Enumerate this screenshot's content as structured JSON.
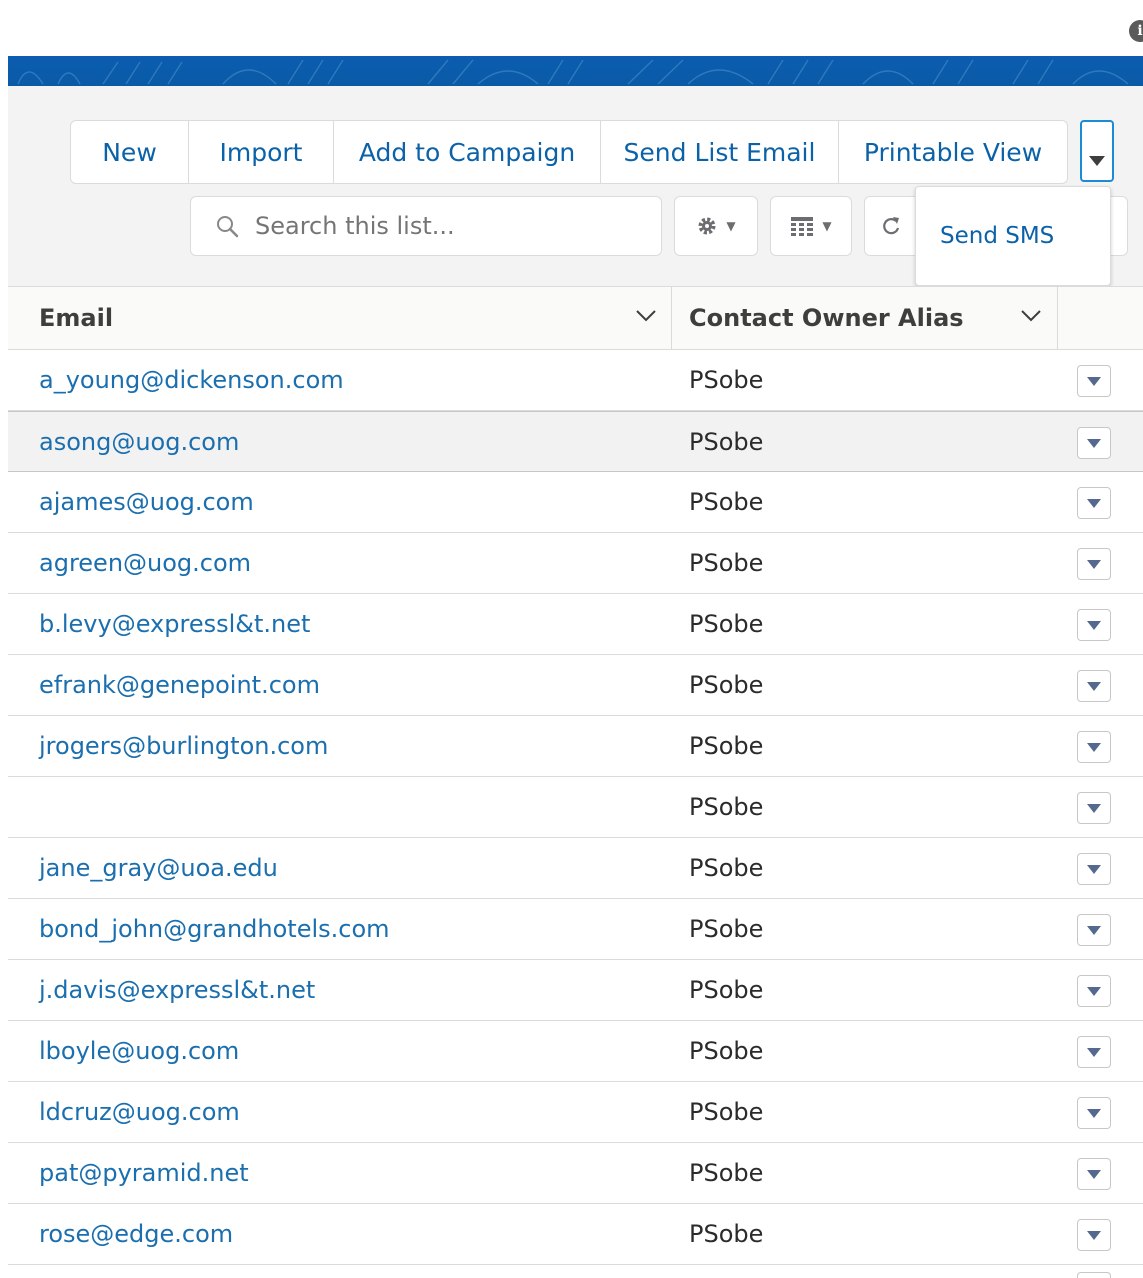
{
  "actions": {
    "new_label": "New",
    "import_label": "Import",
    "add_to_campaign_label": "Add to Campaign",
    "send_list_email_label": "Send List Email",
    "printable_view_label": "Printable View"
  },
  "more_menu": {
    "items": [
      {
        "label": "Send SMS"
      }
    ]
  },
  "search": {
    "placeholder": "Search this list..."
  },
  "toolbar_icons": [
    "gear-icon",
    "table-icon",
    "refresh-icon"
  ],
  "table": {
    "columns": [
      {
        "label": "Email"
      },
      {
        "label": "Contact Owner Alias"
      }
    ],
    "rows": [
      {
        "email": "a_young@dickenson.com",
        "owner": "PSobe"
      },
      {
        "email": "asong@uog.com",
        "owner": "PSobe"
      },
      {
        "email": "ajames@uog.com",
        "owner": "PSobe"
      },
      {
        "email": "agreen@uog.com",
        "owner": "PSobe"
      },
      {
        "email": "b.levy@expressl&t.net",
        "owner": "PSobe"
      },
      {
        "email": "efrank@genepoint.com",
        "owner": "PSobe"
      },
      {
        "email": "jrogers@burlington.com",
        "owner": "PSobe"
      },
      {
        "email": "",
        "owner": "PSobe"
      },
      {
        "email": "jane_gray@uoa.edu",
        "owner": "PSobe"
      },
      {
        "email": "bond_john@grandhotels.com",
        "owner": "PSobe"
      },
      {
        "email": "j.davis@expressl&t.net",
        "owner": "PSobe"
      },
      {
        "email": "lboyle@uog.com",
        "owner": "PSobe"
      },
      {
        "email": "ldcruz@uog.com",
        "owner": "PSobe"
      },
      {
        "email": "pat@pyramid.net",
        "owner": "PSobe"
      },
      {
        "email": "rose@edge.com",
        "owner": "PSobe"
      }
    ]
  },
  "colors": {
    "brand_blue": "#0b5db0",
    "link_blue": "#1b6fae",
    "focus_blue": "#1b8bd6"
  }
}
